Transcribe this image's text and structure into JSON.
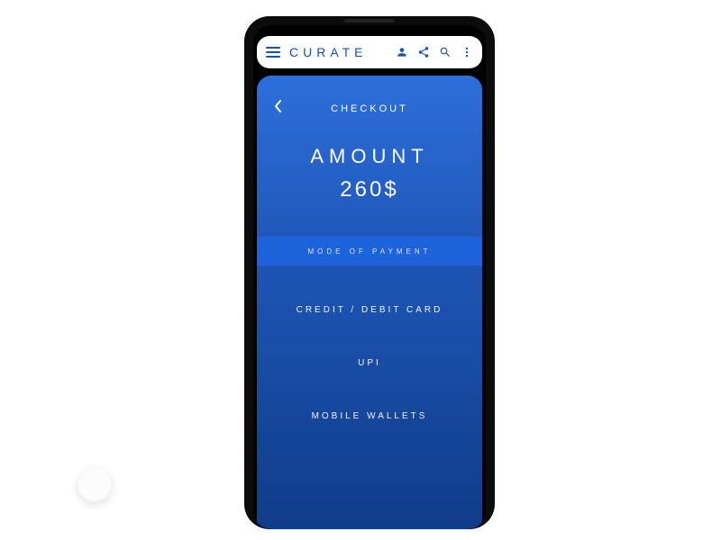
{
  "topbar": {
    "brand": "CURATE"
  },
  "screen": {
    "title": "CHECKOUT",
    "amount_label": "AMOUNT",
    "amount_value": "260$",
    "mode_label": "MODE OF PAYMENT",
    "options": {
      "card": "CREDIT /  DEBIT CARD",
      "upi": "UPI",
      "wallets": "MOBILE WALLETS"
    }
  },
  "colors": {
    "brand": "#1550b5",
    "screen_top": "#2d6fda",
    "screen_bottom": "#103c8a",
    "band": "#1d63dc"
  }
}
